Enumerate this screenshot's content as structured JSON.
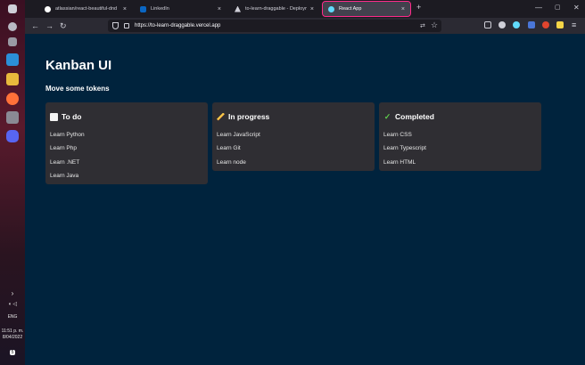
{
  "taskbar": {
    "language": "ENG",
    "time": "11:51 p. m.",
    "date": "8/04/2022",
    "notifications": "5"
  },
  "browser": {
    "tabs": [
      {
        "title": "atlassian/react-beautiful-dnd"
      },
      {
        "title": "LinkedIn"
      },
      {
        "title": "to-learn-draggable - Deploym"
      },
      {
        "title": "React App"
      }
    ],
    "new_tab": "+",
    "url": "https://to-learn-draggable.vercel.app"
  },
  "page": {
    "title": "Kanban UI",
    "subtitle": "Move some tokens",
    "columns": [
      {
        "title": "To do",
        "icon": "notepad-icon",
        "cards": [
          "Learn Python",
          "Learn Php",
          "Learn .NET",
          "Learn Java"
        ]
      },
      {
        "title": "In progress",
        "icon": "pencil-icon",
        "cards": [
          "Learn JavaScript",
          "Learn Git",
          "Learn node"
        ]
      },
      {
        "title": "Completed",
        "icon": "checkmark-icon",
        "cards": [
          "Learn CSS",
          "Learn Typescript",
          "Learn HTML"
        ]
      }
    ]
  },
  "colors": {
    "page_background": "#00233d",
    "column_background": "#2f2e33",
    "checkmark": "#5ec94b"
  }
}
